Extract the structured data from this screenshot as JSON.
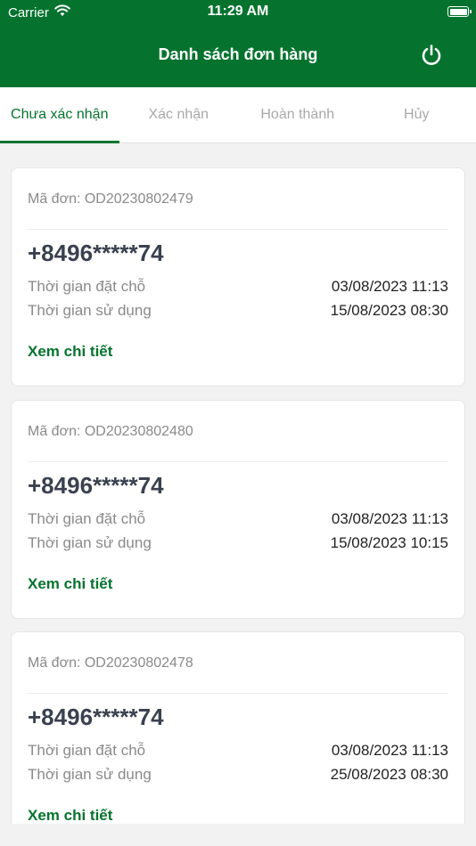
{
  "status_bar": {
    "carrier": "Carrier",
    "time": "11:29 AM"
  },
  "header": {
    "title": "Danh sách đơn hàng",
    "power_icon": "power-icon"
  },
  "tabs": [
    {
      "label": "Chưa xác nhận",
      "active": true
    },
    {
      "label": "Xác nhận",
      "active": false
    },
    {
      "label": "Hoàn thành",
      "active": false
    },
    {
      "label": "Hủy",
      "active": false
    }
  ],
  "orders": [
    {
      "order_id": "Mã đơn: OD20230802479",
      "phone": "+8496*****74",
      "booking_label": "Thời gian đặt chỗ",
      "booking_time": "03/08/2023 11:13",
      "usage_label": "Thời gian sử dụng",
      "usage_time": "15/08/2023 08:30",
      "detail_link": "Xem chi tiết"
    },
    {
      "order_id": "Mã đơn: OD20230802480",
      "phone": "+8496*****74",
      "booking_label": "Thời gian đặt chỗ",
      "booking_time": "03/08/2023 11:13",
      "usage_label": "Thời gian sử dụng",
      "usage_time": "15/08/2023 10:15",
      "detail_link": "Xem chi tiết"
    },
    {
      "order_id": "Mã đơn: OD20230802478",
      "phone": "+8496*****74",
      "booking_label": "Thời gian đặt chỗ",
      "booking_time": "03/08/2023 11:13",
      "usage_label": "Thời gian sử dụng",
      "usage_time": "25/08/2023 08:30",
      "detail_link": "Xem chi tiết"
    }
  ],
  "colors": {
    "brand": "#05732e",
    "background": "#f2f2f2",
    "tab_inactive": "#a9a9a9"
  }
}
